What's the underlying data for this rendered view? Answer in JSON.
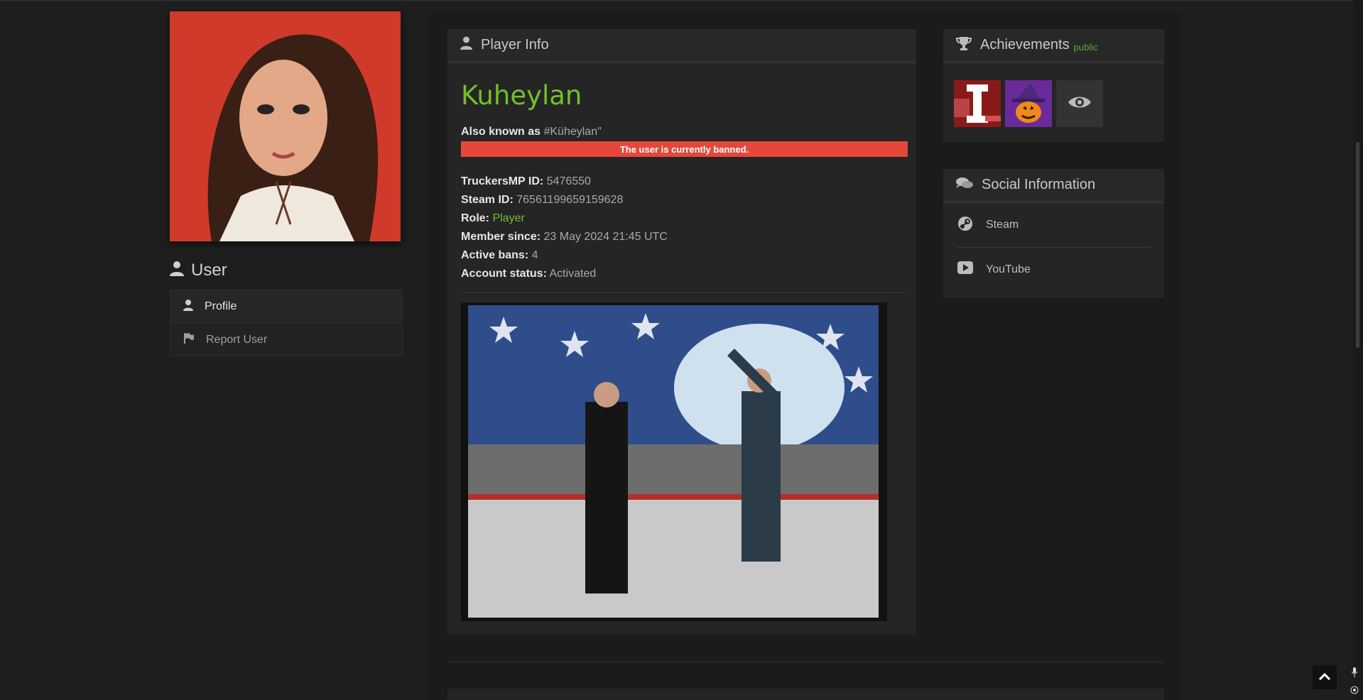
{
  "sidebar": {
    "heading": "User",
    "items": [
      {
        "label": "Profile",
        "icon": "user-icon"
      },
      {
        "label": "Report User",
        "icon": "flag-icon"
      }
    ]
  },
  "player_info": {
    "title": "Player Info",
    "name": "Kuheylan",
    "aka_label": "Also known as",
    "aka_value": "#Küheylan\"",
    "ban_notice": "The user is currently banned.",
    "fields": [
      {
        "label": "TruckersMP ID:",
        "value": "5476550"
      },
      {
        "label": "Steam ID:",
        "value": "76561199659159628"
      },
      {
        "label": "Role:",
        "value": "Player"
      },
      {
        "label": "Member since:",
        "value": "23 May 2024 21:45 UTC"
      },
      {
        "label": "Active bans:",
        "value": "4"
      },
      {
        "label": "Account status:",
        "value": "Activated"
      }
    ]
  },
  "achievements": {
    "title": "Achievements",
    "visibility": "public"
  },
  "social": {
    "title": "Social Information",
    "items": [
      {
        "label": "Steam",
        "icon": "steam-icon"
      },
      {
        "label": "YouTube",
        "icon": "youtube-icon"
      }
    ]
  },
  "colors": {
    "accent_green": "#72c02c",
    "ban_red": "#e5473b",
    "background": "#1e1e1e"
  }
}
